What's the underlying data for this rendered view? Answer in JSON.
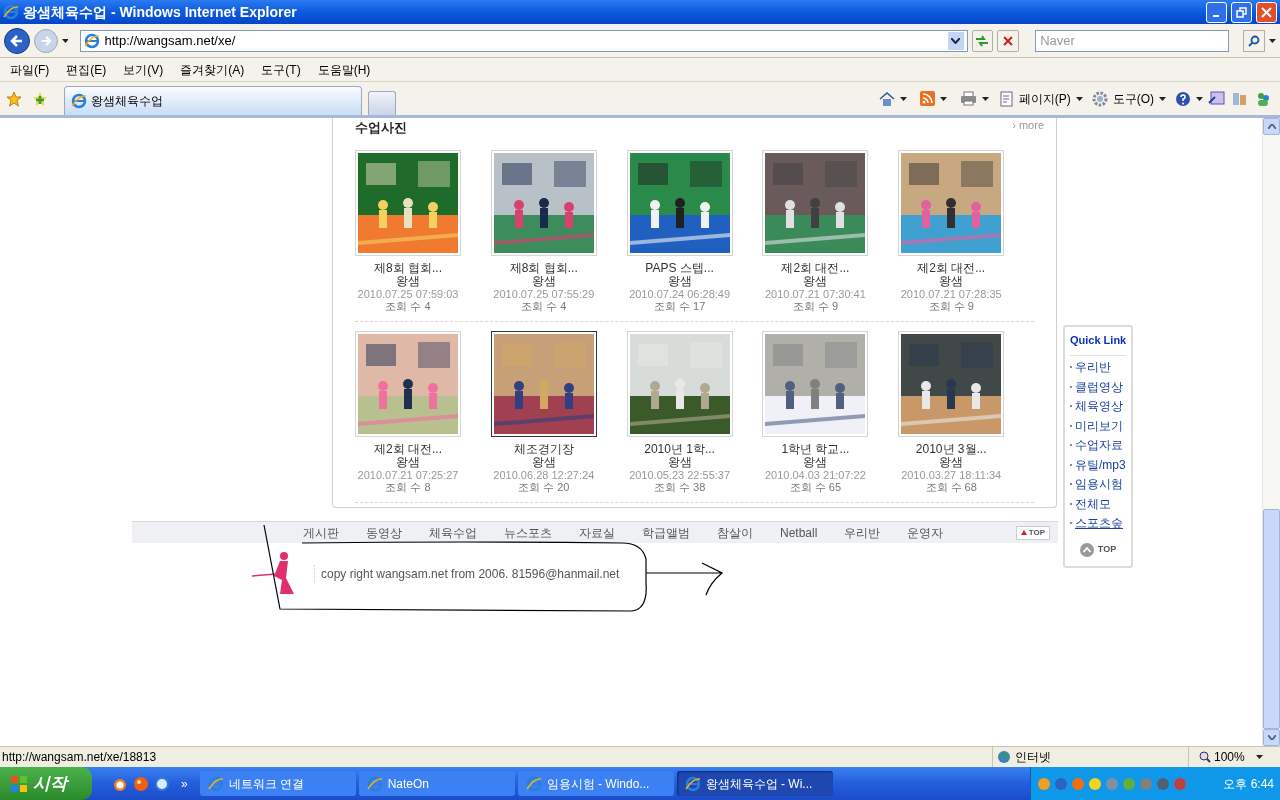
{
  "window": {
    "title": "왕샘체육수업 - Windows Internet Explorer"
  },
  "address_bar": {
    "url": "http://wangsam.net/xe/"
  },
  "search": {
    "placeholder": "Naver"
  },
  "menu": [
    "파일(F)",
    "편집(E)",
    "보기(V)",
    "즐겨찾기(A)",
    "도구(T)",
    "도움말(H)"
  ],
  "tabs": [
    {
      "label": "왕샘체육수업",
      "selected": true
    }
  ],
  "command_bar": [
    "페이지(P)",
    "도구(O)"
  ],
  "gallery": {
    "title": "수업사진",
    "more": "› more",
    "photos": [
      {
        "title": "제8회 협회...",
        "author": "왕샘",
        "date": "2010.07.25 07:59:03",
        "views": "조회 수 4",
        "selected": false
      },
      {
        "title": "제8회 협회...",
        "author": "왕샘",
        "date": "2010.07.25 07:55:29",
        "views": "조회 수 4",
        "selected": false
      },
      {
        "title": "PAPS 스텝...",
        "author": "왕샘",
        "date": "2010.07.24 06:28:49",
        "views": "조회 수 17",
        "selected": false
      },
      {
        "title": "제2회 대전...",
        "author": "왕샘",
        "date": "2010.07.21 07:30:41",
        "views": "조회 수 9",
        "selected": false
      },
      {
        "title": "제2회 대전...",
        "author": "왕샘",
        "date": "2010.07.21 07:28:35",
        "views": "조회 수 9",
        "selected": false
      },
      {
        "title": "제2회 대전...",
        "author": "왕샘",
        "date": "2010.07.21 07:25:27",
        "views": "조회 수 8",
        "selected": false
      },
      {
        "title": "체조경기장",
        "author": "왕샘",
        "date": "2010.06.28 12:27:24",
        "views": "조회 수 20",
        "selected": true
      },
      {
        "title": "2010년 1학...",
        "author": "왕샘",
        "date": "2010.05.23 22:55:37",
        "views": "조회 수 38",
        "selected": false
      },
      {
        "title": "1학년 학교...",
        "author": "왕샘",
        "date": "2010.04.03 21:07:22",
        "views": "조회 수 65",
        "selected": false
      },
      {
        "title": "2010년 3월...",
        "author": "왕샘",
        "date": "2010.03.27 18:11:34",
        "views": "조회 수 68",
        "selected": false
      }
    ]
  },
  "nav": {
    "items": [
      "게시판",
      "동영상",
      "체육수업",
      "뉴스포츠",
      "자료실",
      "학급앨범",
      "참살이",
      "Netball",
      "우리반",
      "운영자"
    ],
    "top": "TOP"
  },
  "quick_link": {
    "title": "Quick Link",
    "items": [
      {
        "label": "우리반",
        "selected": false
      },
      {
        "label": "클럽영상",
        "selected": false
      },
      {
        "label": "체육영상",
        "selected": false
      },
      {
        "label": "미리보기",
        "selected": false
      },
      {
        "label": "수업자료",
        "selected": false
      },
      {
        "label": "유틸/mp3",
        "selected": false
      },
      {
        "label": "임용시험",
        "selected": false
      },
      {
        "label": "전체모",
        "selected": false
      },
      {
        "label": "스포츠숲",
        "selected": true
      }
    ],
    "top": "TOP"
  },
  "footer": {
    "copyright": "copy right wangsam.net from 2006. 81596@hanmail.net"
  },
  "status_bar": {
    "url": "http://wangsam.net/xe/18813",
    "zone": "인터넷",
    "zoom": "100%"
  },
  "taskbar": {
    "start": "시작",
    "more": "»",
    "tasks": [
      {
        "label": "네트워크 연결",
        "selected": false
      },
      {
        "label": "NateOn",
        "selected": false
      },
      {
        "label": "임용시험 - Windo...",
        "selected": false
      },
      {
        "label": "왕샘체육수업 - Wi...",
        "selected": true
      }
    ],
    "clock": "오후 6:44"
  }
}
